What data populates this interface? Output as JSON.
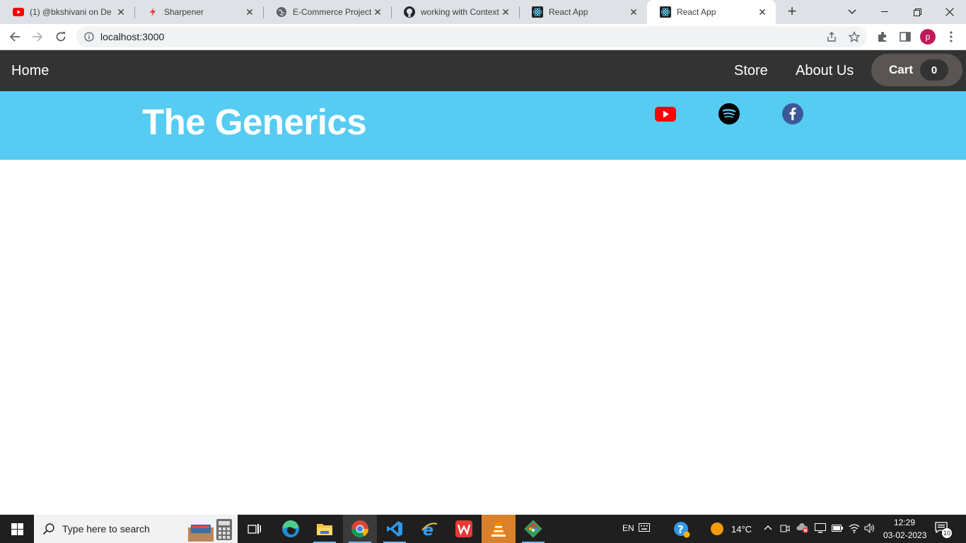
{
  "browser": {
    "tabs": [
      {
        "title": "(1) @bkshivani on De",
        "favicon": "youtube-icon",
        "active": false
      },
      {
        "title": "Sharpener",
        "favicon": "sharpener-icon",
        "active": false
      },
      {
        "title": "E-Commerce Project",
        "favicon": "globe-icon",
        "active": false
      },
      {
        "title": "working with Context",
        "favicon": "github-icon",
        "active": false
      },
      {
        "title": "React App",
        "favicon": "react-icon",
        "active": false
      },
      {
        "title": "React App",
        "favicon": "react-icon",
        "active": true
      }
    ],
    "url": "localhost:3000",
    "profile_initial": "p"
  },
  "page": {
    "nav": {
      "home": "Home",
      "store": "Store",
      "about": "About Us",
      "cart_label": "Cart",
      "cart_count": "0"
    },
    "hero": {
      "title": "The Generics",
      "socials": [
        "youtube-icon",
        "spotify-icon",
        "facebook-icon"
      ]
    },
    "colors": {
      "navbar": "#333333",
      "hero": "#56ccf2",
      "cart_button": "#5a5552"
    }
  },
  "taskbar": {
    "search_placeholder": "Type here to search",
    "language": "EN",
    "weather": "14°C",
    "time": "12:29",
    "date": "03-02-2023",
    "notification_count": "10"
  }
}
